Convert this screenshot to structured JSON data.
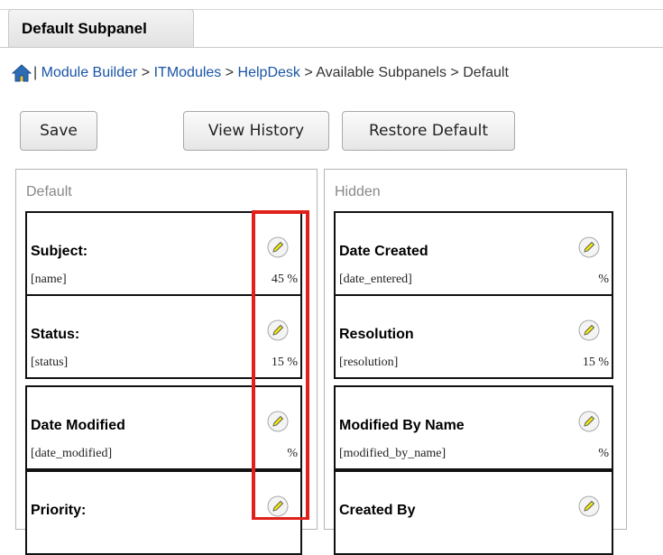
{
  "tab": {
    "label": "Default Subpanel"
  },
  "breadcrumb": {
    "separator_first": "|",
    "module_builder": "Module Builder",
    "sep": ">",
    "itmodules": "ITModules",
    "helpdesk": "HelpDesk",
    "available_subpanels": "Available Subpanels",
    "default": "Default"
  },
  "toolbar": {
    "save": "Save",
    "view_history": "View History",
    "restore_default": "Restore Default"
  },
  "default_panel": {
    "title": "Default",
    "fields": [
      {
        "label": "Subject:",
        "name": "[name]",
        "width": "45 %"
      },
      {
        "label": "Status:",
        "name": "[status]",
        "width": "15 %"
      },
      {
        "label": "Date Modified",
        "name": "[date_modified]",
        "width": "%"
      },
      {
        "label": "Priority:",
        "name": "",
        "width": ""
      }
    ]
  },
  "hidden_panel": {
    "title": "Hidden",
    "fields": [
      {
        "label": "Date Created",
        "name": "[date_entered]",
        "width": "%"
      },
      {
        "label": "Resolution",
        "name": "[resolution]",
        "width": "15 %"
      },
      {
        "label": "Modified By Name",
        "name": "[modified_by_name]",
        "width": "%"
      },
      {
        "label": "Created By",
        "name": "",
        "width": ""
      }
    ]
  },
  "colors": {
    "link": "#1a55a6",
    "highlight": "#e0201a",
    "edit_icon": "#f1e80a"
  }
}
